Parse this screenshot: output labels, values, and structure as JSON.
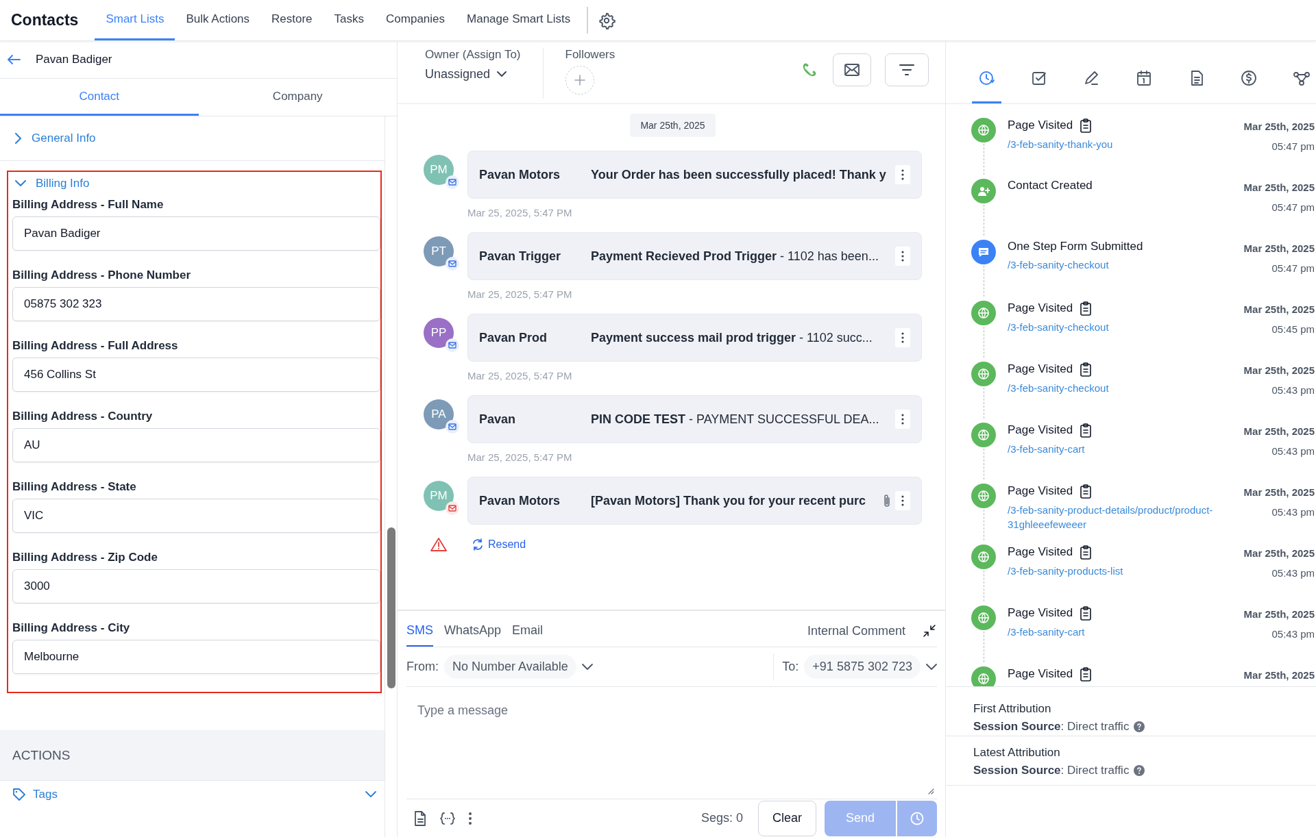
{
  "nav": {
    "title": "Contacts",
    "tabs": [
      {
        "label": "Smart Lists",
        "selected": true
      },
      {
        "label": "Bulk Actions",
        "selected": false
      },
      {
        "label": "Restore",
        "selected": false
      },
      {
        "label": "Tasks",
        "selected": false
      },
      {
        "label": "Companies",
        "selected": false
      },
      {
        "label": "Manage Smart Lists",
        "selected": false
      }
    ]
  },
  "contact": {
    "name": "Pavan Badiger"
  },
  "panel_tabs": [
    {
      "label": "Contact",
      "selected": true
    },
    {
      "label": "Company",
      "selected": false
    }
  ],
  "sections": [
    {
      "title": "General Info",
      "expanded": false,
      "highlighted": false
    },
    {
      "title": "Billing Info",
      "expanded": true,
      "highlighted": true,
      "fields": [
        {
          "label": "Billing Address - Full Name",
          "value": "Pavan Badiger"
        },
        {
          "label": "Billing Address - Phone Number",
          "value": "05875 302 323"
        },
        {
          "label": "Billing Address - Full Address",
          "value": "456 Collins St"
        },
        {
          "label": "Billing Address - Country",
          "value": "AU"
        },
        {
          "label": "Billing Address - State",
          "value": "VIC"
        },
        {
          "label": "Billing Address - Zip Code",
          "value": "3000"
        },
        {
          "label": "Billing Address - City",
          "value": "Melbourne"
        }
      ]
    }
  ],
  "actions": {
    "title": "ACTIONS",
    "items": [
      {
        "label": "Tags",
        "expanded": false
      }
    ]
  },
  "owner": {
    "label": "Owner (Assign To)",
    "value": "Unassigned"
  },
  "followers": {
    "label": "Followers"
  },
  "date_divider": "Mar 25th, 2025",
  "messages": [
    {
      "initials": "PM",
      "color": "#7fc1b3",
      "sender": "Pavan Motors",
      "subject": "Your Order has been successfully placed! Thank y",
      "time": "Mar 25, 2025, 5:47 PM",
      "failed": false,
      "attachment": false
    },
    {
      "initials": "PT",
      "color": "#7d9bb6",
      "sender": "Pavan Trigger",
      "subject": "Payment Recieved Prod Trigger",
      "separator": "-",
      "preview": "1102 has been...",
      "time": "Mar 25, 2025, 5:47 PM",
      "failed": false,
      "attachment": false
    },
    {
      "initials": "PP",
      "color": "#9a6fc6",
      "sender": "Pavan Prod",
      "subject": "Payment success mail prod trigger",
      "separator": "-",
      "preview": "1102 succ...",
      "time": "Mar 25, 2025, 5:47 PM",
      "failed": false,
      "attachment": false
    },
    {
      "initials": "PA",
      "color": "#7d9bb6",
      "sender": "Pavan",
      "subject": "PIN CODE TEST",
      "separator": "-",
      "preview": "PAYMENT SUCCESSFUL DEA...",
      "time": "Mar 25, 2025, 5:47 PM",
      "failed": false,
      "attachment": false
    },
    {
      "initials": "PM",
      "color": "#7fc1b3",
      "sender": "Pavan Motors",
      "subject": "[Pavan Motors] Thank you for your recent purc",
      "failed": true,
      "attachment": true,
      "resend": "Resend"
    }
  ],
  "composer": {
    "channels": [
      {
        "label": "SMS",
        "selected": true
      },
      {
        "label": "WhatsApp",
        "selected": false
      },
      {
        "label": "Email",
        "selected": false
      }
    ],
    "internal_comment": "Internal Comment",
    "from_label": "From:",
    "from_value": "No Number Available",
    "to_label": "To:",
    "to_value": "+91 5875 302 723",
    "placeholder": "Type a message",
    "segments": "Segs: 0",
    "clear": "Clear",
    "send": "Send",
    "send_disabled": true
  },
  "activity_tabs": [
    {
      "kind": "history",
      "selected": true
    },
    {
      "kind": "task",
      "selected": false
    },
    {
      "kind": "note",
      "selected": false
    },
    {
      "kind": "calendar",
      "selected": false
    },
    {
      "kind": "document",
      "selected": false
    },
    {
      "kind": "dollar",
      "selected": false
    },
    {
      "kind": "workflow",
      "selected": false
    }
  ],
  "timeline": [
    {
      "kind": "page_visit",
      "title": "Page Visited",
      "link": "/3-feb-sanity-thank-you",
      "date": "Mar 25th, 2025",
      "time": "05:47 pm"
    },
    {
      "kind": "contact_created",
      "title": "Contact Created",
      "date": "Mar 25th, 2025",
      "time": "05:47 pm"
    },
    {
      "kind": "form_submitted",
      "title": "One Step Form Submitted",
      "link": "/3-feb-sanity-checkout",
      "date": "Mar 25th, 2025",
      "time": "05:47 pm"
    },
    {
      "kind": "page_visit",
      "title": "Page Visited",
      "link": "/3-feb-sanity-checkout",
      "date": "Mar 25th, 2025",
      "time": "05:45 pm"
    },
    {
      "kind": "page_visit",
      "title": "Page Visited",
      "link": "/3-feb-sanity-checkout",
      "date": "Mar 25th, 2025",
      "time": "05:43 pm"
    },
    {
      "kind": "page_visit",
      "title": "Page Visited",
      "link": "/3-feb-sanity-cart",
      "date": "Mar 25th, 2025",
      "time": "05:43 pm"
    },
    {
      "kind": "page_visit",
      "title": "Page Visited",
      "link": "/3-feb-sanity-product-details/product/product-31ghleeefeweeer",
      "date": "Mar 25th, 2025",
      "time": "05:43 pm"
    },
    {
      "kind": "page_visit",
      "title": "Page Visited",
      "link": "/3-feb-sanity-products-list",
      "date": "Mar 25th, 2025",
      "time": "05:43 pm"
    },
    {
      "kind": "page_visit",
      "title": "Page Visited",
      "link": "/3-feb-sanity-cart",
      "date": "Mar 25th, 2025",
      "time": "05:43 pm"
    },
    {
      "kind": "page_visit",
      "title": "Page Visited",
      "date": "Mar 25th, 2025"
    }
  ],
  "attribution": [
    {
      "title": "First Attribution",
      "detail": "**Session Source**: Direct traffic"
    },
    {
      "title": "Latest Attribution",
      "detail": "**Session Source**: Direct traffic"
    }
  ]
}
